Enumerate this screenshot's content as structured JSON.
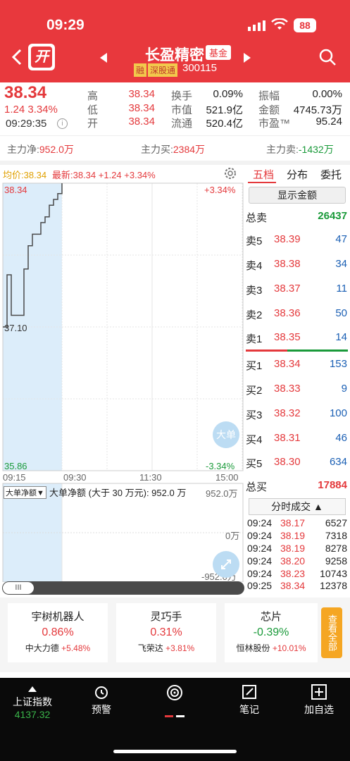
{
  "status_bar": {
    "time": "09:29",
    "battery": "88"
  },
  "header": {
    "kai_label": "开",
    "stock_name": "长盈精密",
    "fund_tag": "基金",
    "rong_tag": "融",
    "sgt_tag": "深股通",
    "stock_code": "300115"
  },
  "quote": {
    "price": "38.34",
    "change": "1.24 3.34%",
    "time": "09:29:35",
    "high_label": "高",
    "high": "38.34",
    "low_label": "低",
    "low": "38.34",
    "open_label": "开",
    "open": "38.34",
    "turnover_label": "换手",
    "turnover": "0.09%",
    "mktcap_label": "市值",
    "mktcap": "521.9亿",
    "float_label": "流通",
    "float": "520.4亿",
    "amplitude_label": "振幅",
    "amplitude": "0.00%",
    "amount_label": "金额",
    "amount": "4745.73万",
    "pe_label": "市盈™",
    "pe": "95.24"
  },
  "flows": {
    "net_label": "主力净:",
    "net": "952.0万",
    "buy_label": "主力买:",
    "buy": "2384万",
    "sell_label": "主力卖:",
    "sell": "-1432万"
  },
  "chart": {
    "avg_label": "均价:38.34",
    "latest_label": "最新:38.34 +1.24 +3.34%",
    "y_top": "38.34",
    "y_mid": "37.10",
    "y_bottom": "35.86",
    "pct_top": "+3.34%",
    "pct_bottom": "-3.34%",
    "big_order_label": "大单",
    "time_ticks": [
      "09:15",
      "09:30",
      "11:30",
      "15:00"
    ],
    "sub_select": "大单净额▼",
    "sub_title": "大单净额 (大于 30 万元): 952.0 万",
    "sub_top": "952.0万",
    "sub_zero": "0万",
    "sub_bottom": "-952.0万",
    "scroll_label": "III"
  },
  "chart_data": {
    "type": "line",
    "x": [
      "09:15",
      "09:16",
      "09:17",
      "09:18",
      "09:19",
      "09:20",
      "09:21",
      "09:22",
      "09:23",
      "09:24",
      "09:25",
      "09:26",
      "09:27",
      "09:28",
      "09:29"
    ],
    "series": [
      {
        "values": [
          37.1,
          37.55,
          37.2,
          37.2,
          37.2,
          37.6,
          37.8,
          37.9,
          37.9,
          38.0,
          38.05,
          38.15,
          38.2,
          38.25,
          38.34
        ]
      }
    ],
    "ylim": [
      35.86,
      38.34
    ]
  },
  "order_book": {
    "tabs": [
      "五档",
      "分布",
      "委托"
    ],
    "show_amount": "显示金额",
    "total_sell_label": "总卖",
    "total_sell": "26437",
    "asks": [
      {
        "label": "卖5",
        "price": "38.39",
        "vol": "47"
      },
      {
        "label": "卖4",
        "price": "38.38",
        "vol": "34"
      },
      {
        "label": "卖3",
        "price": "38.37",
        "vol": "11"
      },
      {
        "label": "卖2",
        "price": "38.36",
        "vol": "50"
      },
      {
        "label": "卖1",
        "price": "38.35",
        "vol": "14"
      }
    ],
    "bids": [
      {
        "label": "买1",
        "price": "38.34",
        "vol": "153"
      },
      {
        "label": "买2",
        "price": "38.33",
        "vol": "9"
      },
      {
        "label": "买3",
        "price": "38.32",
        "vol": "100"
      },
      {
        "label": "买4",
        "price": "38.31",
        "vol": "46"
      },
      {
        "label": "买5",
        "price": "38.30",
        "vol": "634"
      }
    ],
    "total_buy_label": "总买",
    "total_buy": "17884",
    "ticks_header": "分时成交 ▲",
    "ticks": [
      {
        "t": "09:24",
        "p": "38.17",
        "v": "6527"
      },
      {
        "t": "09:24",
        "p": "38.19",
        "v": "7318"
      },
      {
        "t": "09:24",
        "p": "38.19",
        "v": "8278"
      },
      {
        "t": "09:24",
        "p": "38.20",
        "v": "9258"
      },
      {
        "t": "09:24",
        "p": "38.23",
        "v": "10743"
      },
      {
        "t": "09:25",
        "p": "38.34",
        "v": "12378"
      }
    ]
  },
  "sectors": [
    {
      "name": "宇树机器人",
      "change": "0.86%",
      "stock": "中大力德",
      "stock_change": "+5.48%",
      "color": "#e4393c"
    },
    {
      "name": "灵巧手",
      "change": "0.31%",
      "stock": "飞荣达",
      "stock_change": "+3.81%",
      "color": "#e4393c"
    },
    {
      "name": "芯片",
      "change": "-0.39%",
      "stock": "恒林股份",
      "stock_change": "+10.01%",
      "color": "#1a9a3a"
    }
  ],
  "view_all": "查看全部",
  "bottom_nav": {
    "index_name": "上证指数",
    "index_value": "4137.32",
    "alert": "预警",
    "notes": "笔记",
    "add_watch": "加自选"
  }
}
